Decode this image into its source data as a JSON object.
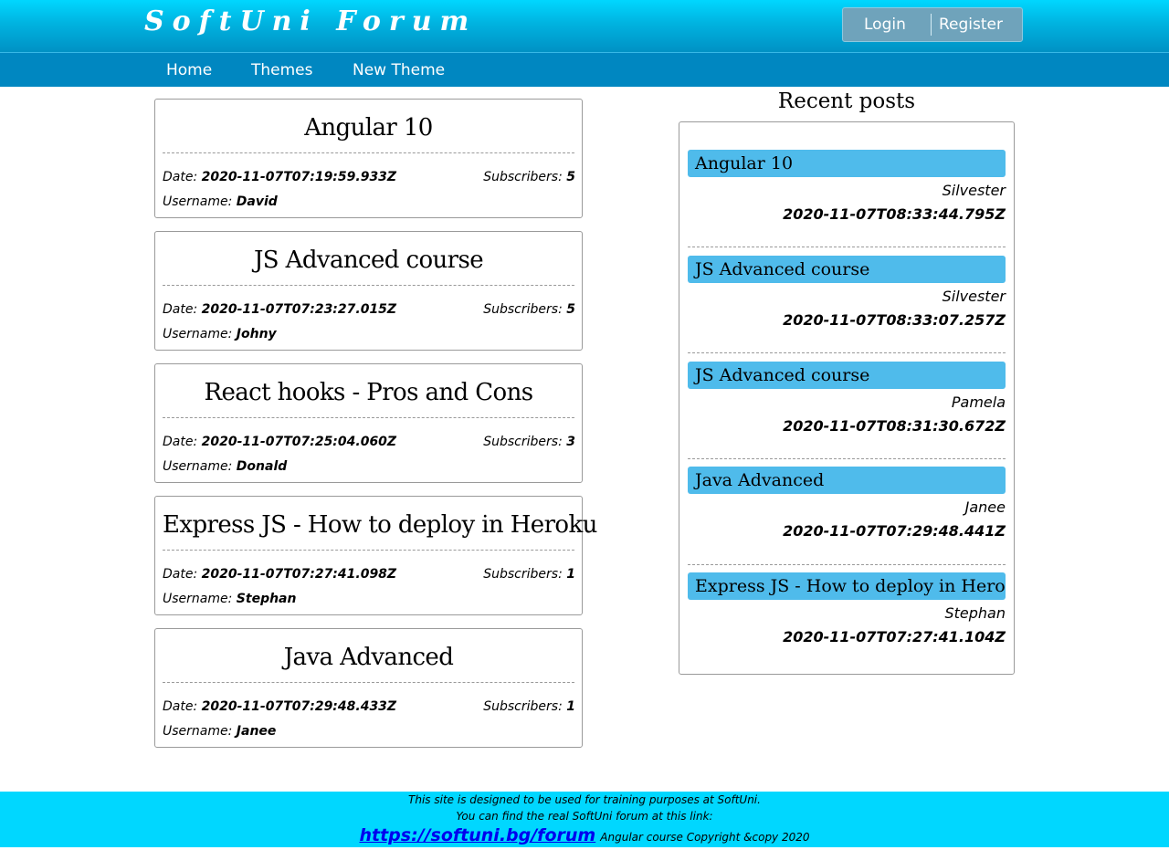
{
  "header": {
    "logo": "SoftUni Forum",
    "login": "Login",
    "register": "Register"
  },
  "nav": {
    "home": "Home",
    "themes": "Themes",
    "new_theme": "New Theme"
  },
  "themes": [
    {
      "title": "Angular 10",
      "date_label": "Date:",
      "date": "2020-11-07T07:19:59.933Z",
      "subscribers_label": "Subscribers:",
      "subscribers": "5",
      "username_label": "Username:",
      "username": "David"
    },
    {
      "title": "JS Advanced course",
      "date_label": "Date:",
      "date": "2020-11-07T07:23:27.015Z",
      "subscribers_label": "Subscribers:",
      "subscribers": "5",
      "username_label": "Username:",
      "username": "Johny"
    },
    {
      "title": "React hooks - Pros and Cons",
      "date_label": "Date:",
      "date": "2020-11-07T07:25:04.060Z",
      "subscribers_label": "Subscribers:",
      "subscribers": "3",
      "username_label": "Username:",
      "username": "Donald"
    },
    {
      "title": "Express JS - How to deploy in Heroku",
      "date_label": "Date:",
      "date": "2020-11-07T07:27:41.098Z",
      "subscribers_label": "Subscribers:",
      "subscribers": "1",
      "username_label": "Username:",
      "username": "Stephan"
    },
    {
      "title": "Java Advanced",
      "date_label": "Date:",
      "date": "2020-11-07T07:29:48.433Z",
      "subscribers_label": "Subscribers:",
      "subscribers": "1",
      "username_label": "Username:",
      "username": "Janee"
    }
  ],
  "recent": {
    "title": "Recent posts",
    "posts": [
      {
        "theme": "Angular 10",
        "user": "Silvester",
        "date": "2020-11-07T08:33:44.795Z"
      },
      {
        "theme": "JS Advanced course",
        "user": "Silvester",
        "date": "2020-11-07T08:33:07.257Z"
      },
      {
        "theme": "JS Advanced course",
        "user": "Pamela",
        "date": "2020-11-07T08:31:30.672Z"
      },
      {
        "theme": "Java Advanced",
        "user": "Janee",
        "date": "2020-11-07T07:29:48.441Z"
      },
      {
        "theme": "Express JS - How to deploy in Heroku",
        "user": "Stephan",
        "date": "2020-11-07T07:27:41.104Z"
      }
    ]
  },
  "footer": {
    "line1": "This site is designed to be used for training purposes at SoftUni.",
    "line2": "You can find the real SoftUni forum at this link:",
    "link": "https://softuni.bg/forum",
    "copyright": "Angular course Copyright &copy 2020"
  }
}
